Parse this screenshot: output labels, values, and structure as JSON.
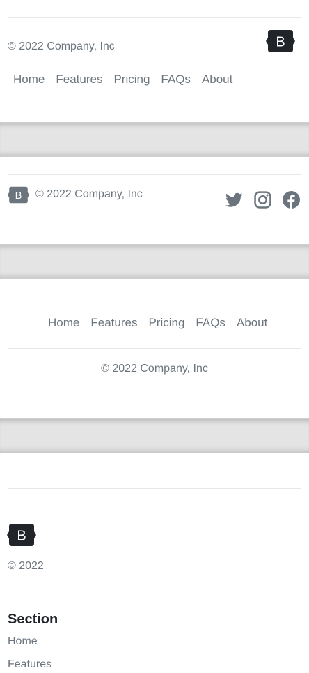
{
  "footer1": {
    "copyright": "© 2022 Company, Inc",
    "nav": [
      "Home",
      "Features",
      "Pricing",
      "FAQs",
      "About"
    ],
    "logo_letter": "B"
  },
  "footer2": {
    "copyright": "© 2022 Company, Inc",
    "logo_letter": "B",
    "social": [
      "twitter-icon",
      "instagram-icon",
      "facebook-icon"
    ]
  },
  "footer3": {
    "nav": [
      "Home",
      "Features",
      "Pricing",
      "FAQs",
      "About"
    ],
    "copyright": "© 2022 Company, Inc"
  },
  "footer4": {
    "logo_letter": "B",
    "copyright": "© 2022",
    "section_title": "Section",
    "links": [
      "Home",
      "Features"
    ]
  },
  "colors": {
    "text_muted": "#6c757d",
    "logo_dark": "#212529",
    "divider": "#e4e4e4"
  }
}
